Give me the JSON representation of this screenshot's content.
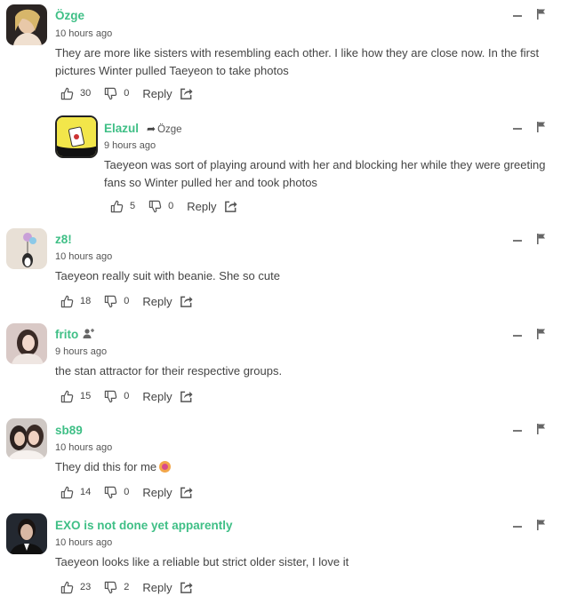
{
  "comments": [
    {
      "username": "Özge",
      "time": "10 hours ago",
      "text": "They are more like sisters with resembling each other. I like how they are close now. In the first pictures Winter pulled Taeyeon to take photos",
      "upvotes": "30",
      "downvotes": "0",
      "reply_label": "Reply"
    },
    {
      "username": "Elazul",
      "reply_to": "Özge",
      "time": "9 hours ago",
      "text": "Taeyeon was sort of playing around with her and blocking her while they were greeting fans so Winter pulled her and took photos",
      "upvotes": "5",
      "downvotes": "0",
      "reply_label": "Reply"
    },
    {
      "username": "z8!",
      "time": "10 hours ago",
      "text": "Taeyeon really suit with beanie. She so cute",
      "upvotes": "18",
      "downvotes": "0",
      "reply_label": "Reply"
    },
    {
      "username": "frito",
      "time": "9 hours ago",
      "text": "the stan attractor for their respective groups.",
      "upvotes": "15",
      "downvotes": "0",
      "reply_label": "Reply"
    },
    {
      "username": "sb89",
      "time": "10 hours ago",
      "text": "They did this for me",
      "upvotes": "14",
      "downvotes": "0",
      "reply_label": "Reply"
    },
    {
      "username": "EXO is not done yet apparently",
      "time": "10 hours ago",
      "text": "Taeyeon looks like a reliable but strict older sister, I love it",
      "upvotes": "23",
      "downvotes": "2",
      "reply_label": "Reply"
    }
  ],
  "colors": {
    "username": "#3fbf86",
    "text": "#444444",
    "icons": "#555555"
  },
  "icons": [
    "thumbs-up-icon",
    "thumbs-down-icon",
    "share-icon",
    "minimize-icon",
    "flag-icon",
    "follow-icon",
    "reply-arrow-icon",
    "emoji-icon"
  ]
}
